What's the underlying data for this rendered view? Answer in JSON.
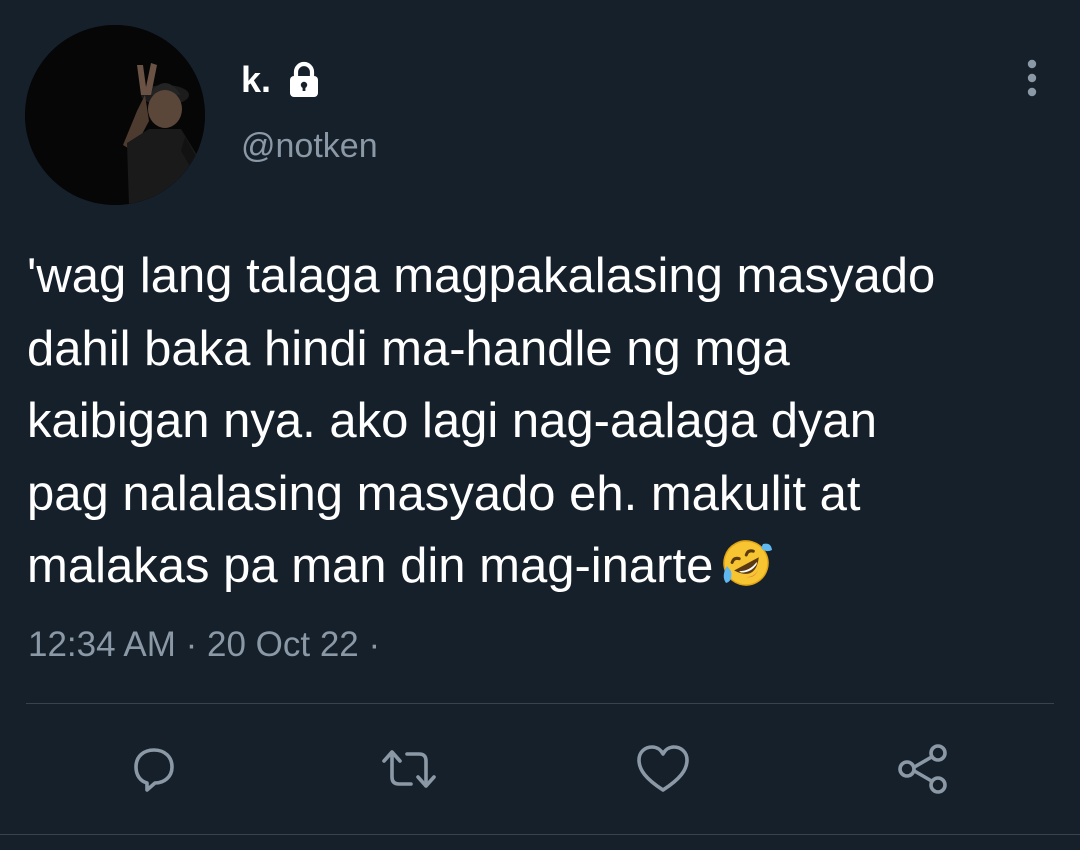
{
  "tweet": {
    "display_name": "k.",
    "handle": "@notken",
    "text_lines": [
      "'wag lang talaga magpakalasing masyado",
      "dahil baka hindi ma-handle ng mga",
      "kaibigan nya. ako lagi nag-aalaga dyan",
      "pag nalalasing masyado eh. makulit at",
      "malakas pa man din mag-inarte"
    ],
    "emoji": "rolling-on-the-floor-laughing",
    "time": "12:34 AM",
    "date": "20 Oct 22",
    "meta_separator": "·"
  },
  "icons": {
    "protected": "lock-icon",
    "more": "more-vertical-icon",
    "reply": "reply-icon",
    "retweet": "retweet-icon",
    "like": "heart-icon",
    "share": "share-icon"
  },
  "colors": {
    "background": "#15202b",
    "text_primary": "#ffffff",
    "text_secondary": "#8b98a5",
    "divider": "#38444d"
  }
}
